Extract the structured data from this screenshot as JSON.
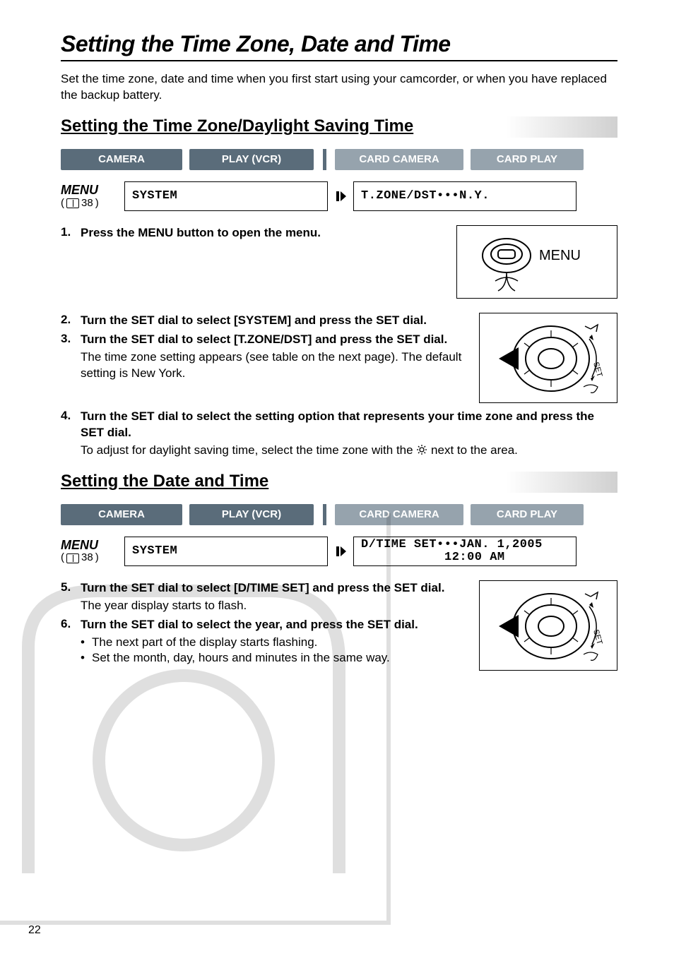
{
  "title": "Setting the Time Zone, Date and Time",
  "intro": "Set the time zone, date and time when you first start using your camcorder, or when you have replaced the backup battery.",
  "section1": {
    "heading": "Setting the Time Zone/Daylight Saving Time",
    "modes": {
      "camera": "CAMERA",
      "play": "PLAY (VCR)",
      "card_camera": "CARD CAMERA",
      "card_play": "CARD PLAY"
    },
    "menu": {
      "label": "MENU",
      "ref": "38",
      "box1": "SYSTEM",
      "box2": "T.ZONE/DST•••N.Y."
    },
    "illus": {
      "menu_label": "MENU",
      "dial_set": "SET"
    },
    "steps": {
      "s1": {
        "num": "1.",
        "bold": "Press the MENU button to open the menu."
      },
      "s2": {
        "num": "2.",
        "bold": "Turn the SET dial to select [SYSTEM] and press the SET dial."
      },
      "s3": {
        "num": "3.",
        "bold": "Turn the SET dial to select [T.ZONE/DST] and press the SET dial.",
        "desc": "The time zone setting appears (see table on the next page). The default setting is New York."
      },
      "s4": {
        "num": "4.",
        "bold": "Turn the SET dial to select the setting option that represents your time zone and press the SET dial.",
        "desc_pre": "To adjust for daylight saving time, select the time zone with the ",
        "desc_post": " next to the area."
      }
    }
  },
  "section2": {
    "heading": "Setting the Date and Time",
    "modes": {
      "camera": "CAMERA",
      "play": "PLAY (VCR)",
      "card_camera": "CARD CAMERA",
      "card_play": "CARD PLAY"
    },
    "menu": {
      "label": "MENU",
      "ref": "38",
      "box1": "SYSTEM",
      "box2_l1": "D/TIME SET•••JAN. 1,2005",
      "box2_l2": "12:00 AM"
    },
    "illus": {
      "dial_set": "SET"
    },
    "steps": {
      "s5": {
        "num": "5.",
        "bold": "Turn the SET dial to select [D/TIME SET] and press the SET dial.",
        "desc": "The year display starts to flash."
      },
      "s6": {
        "num": "6.",
        "bold": "Turn the SET dial to select the year, and press the SET dial.",
        "b1": "The next part of the display starts flashing.",
        "b2": "Set the month, day, hours and minutes in the same way."
      }
    }
  },
  "page_number": "22"
}
